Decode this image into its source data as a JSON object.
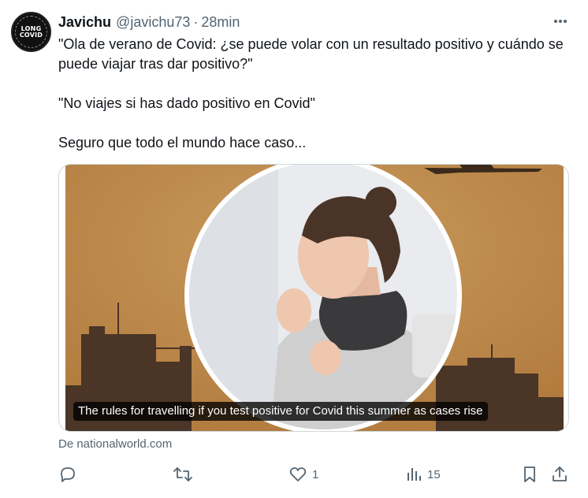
{
  "tweet": {
    "author_name": "Javichu",
    "author_handle": "@javichu73",
    "separator": "·",
    "time": "28min",
    "avatar_text_top": "LONG",
    "avatar_text_bottom": "COVID",
    "lines": [
      "\"Ola de verano de Covid: ¿se puede volar con un resultado positivo y cuándo se puede viajar tras dar positivo?\"",
      "\"No viajes si has dado positivo en Covid\"",
      "Seguro que todo el mundo hace caso..."
    ]
  },
  "card": {
    "caption": "The rules for travelling if you test positive for Covid this summer as cases rise",
    "source": "De nationalworld.com"
  },
  "actions": {
    "reply_count": "",
    "retweet_count": "",
    "like_count": "1",
    "views_count": "15"
  },
  "icons": {
    "more": "more-horizontal-icon",
    "reply": "reply-icon",
    "retweet": "retweet-icon",
    "like": "heart-icon",
    "views": "views-chart-icon",
    "bookmark": "bookmark-icon",
    "share": "share-icon"
  },
  "colors": {
    "text": "#0f1419",
    "secondary": "#536471",
    "border": "#cfd9de",
    "image_bg": "#c08f52"
  }
}
